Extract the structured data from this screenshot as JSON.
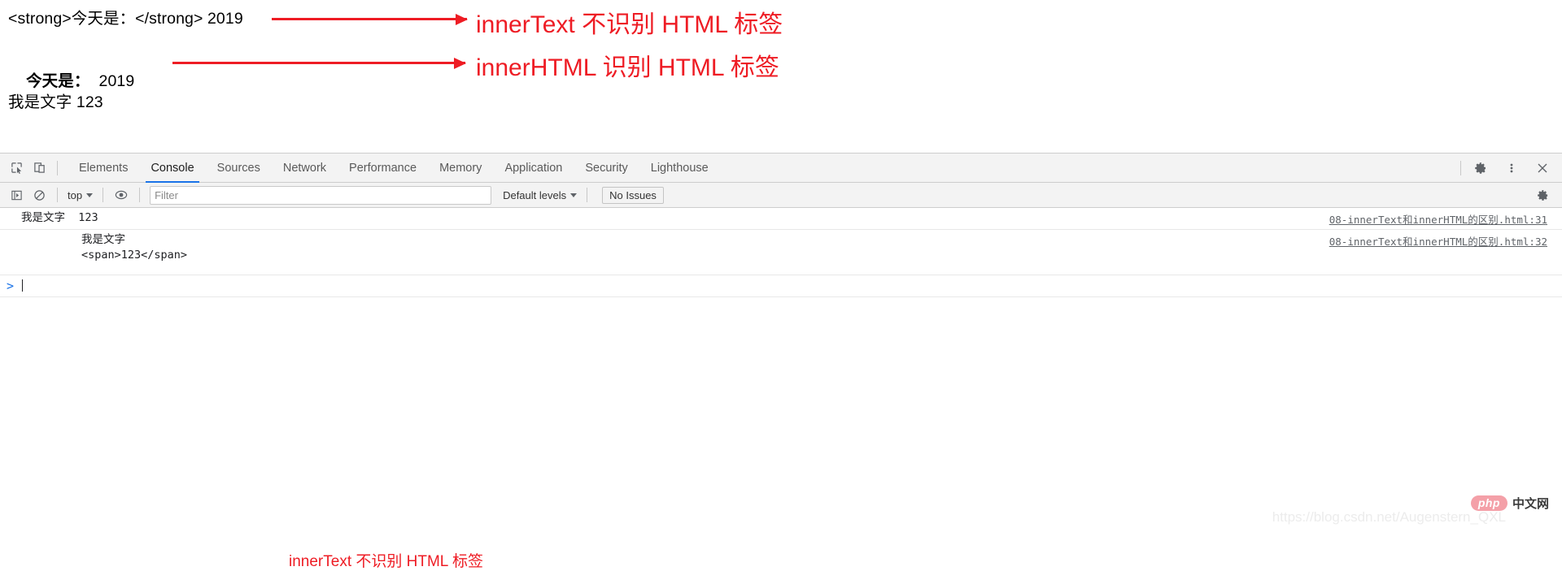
{
  "page": {
    "line1_raw": "<strong>今天是：</strong> 2019",
    "line2_bold": "今天是：",
    "line2_rest": "  2019",
    "line3": "我是文字 123"
  },
  "annotations": {
    "arrow1_text": "innerText 不识别 HTML 标签",
    "arrow2_text": "innerHTML 识别 HTML 标签",
    "console_note": "innerText 不识别 HTML 标签",
    "color": "#ee1c24"
  },
  "devtools": {
    "tabs": [
      {
        "label": "Elements",
        "active": false
      },
      {
        "label": "Console",
        "active": true
      },
      {
        "label": "Sources",
        "active": false
      },
      {
        "label": "Network",
        "active": false
      },
      {
        "label": "Performance",
        "active": false
      },
      {
        "label": "Memory",
        "active": false
      },
      {
        "label": "Application",
        "active": false
      },
      {
        "label": "Security",
        "active": false
      },
      {
        "label": "Lighthouse",
        "active": false
      }
    ],
    "icons": {
      "inspect": "inspect-element-icon",
      "device": "device-toolbar-icon",
      "settings": "gear-icon",
      "more": "more-vertical-icon",
      "close": "close-icon",
      "execute": "execute-sidebar-icon",
      "clear": "clear-console-icon",
      "eye": "live-expression-icon"
    },
    "console_toolbar": {
      "context": "top",
      "filter_placeholder": "Filter",
      "filter_value": "",
      "levels": "Default levels",
      "issues": "No Issues"
    },
    "logs": [
      {
        "text": "我是文字  123",
        "source": "08-innerText和innerHTML的区别.html:31",
        "indent": false
      },
      {
        "text": "我是文字\n<span>123</span>",
        "source": "08-innerText和innerHTML的区别.html:32",
        "indent": true
      }
    ],
    "prompt": ">"
  },
  "watermark": {
    "csdn": "https://blog.csdn.net/Augenstern_QXL",
    "php_badge": "php",
    "php_cn": "中文网"
  }
}
